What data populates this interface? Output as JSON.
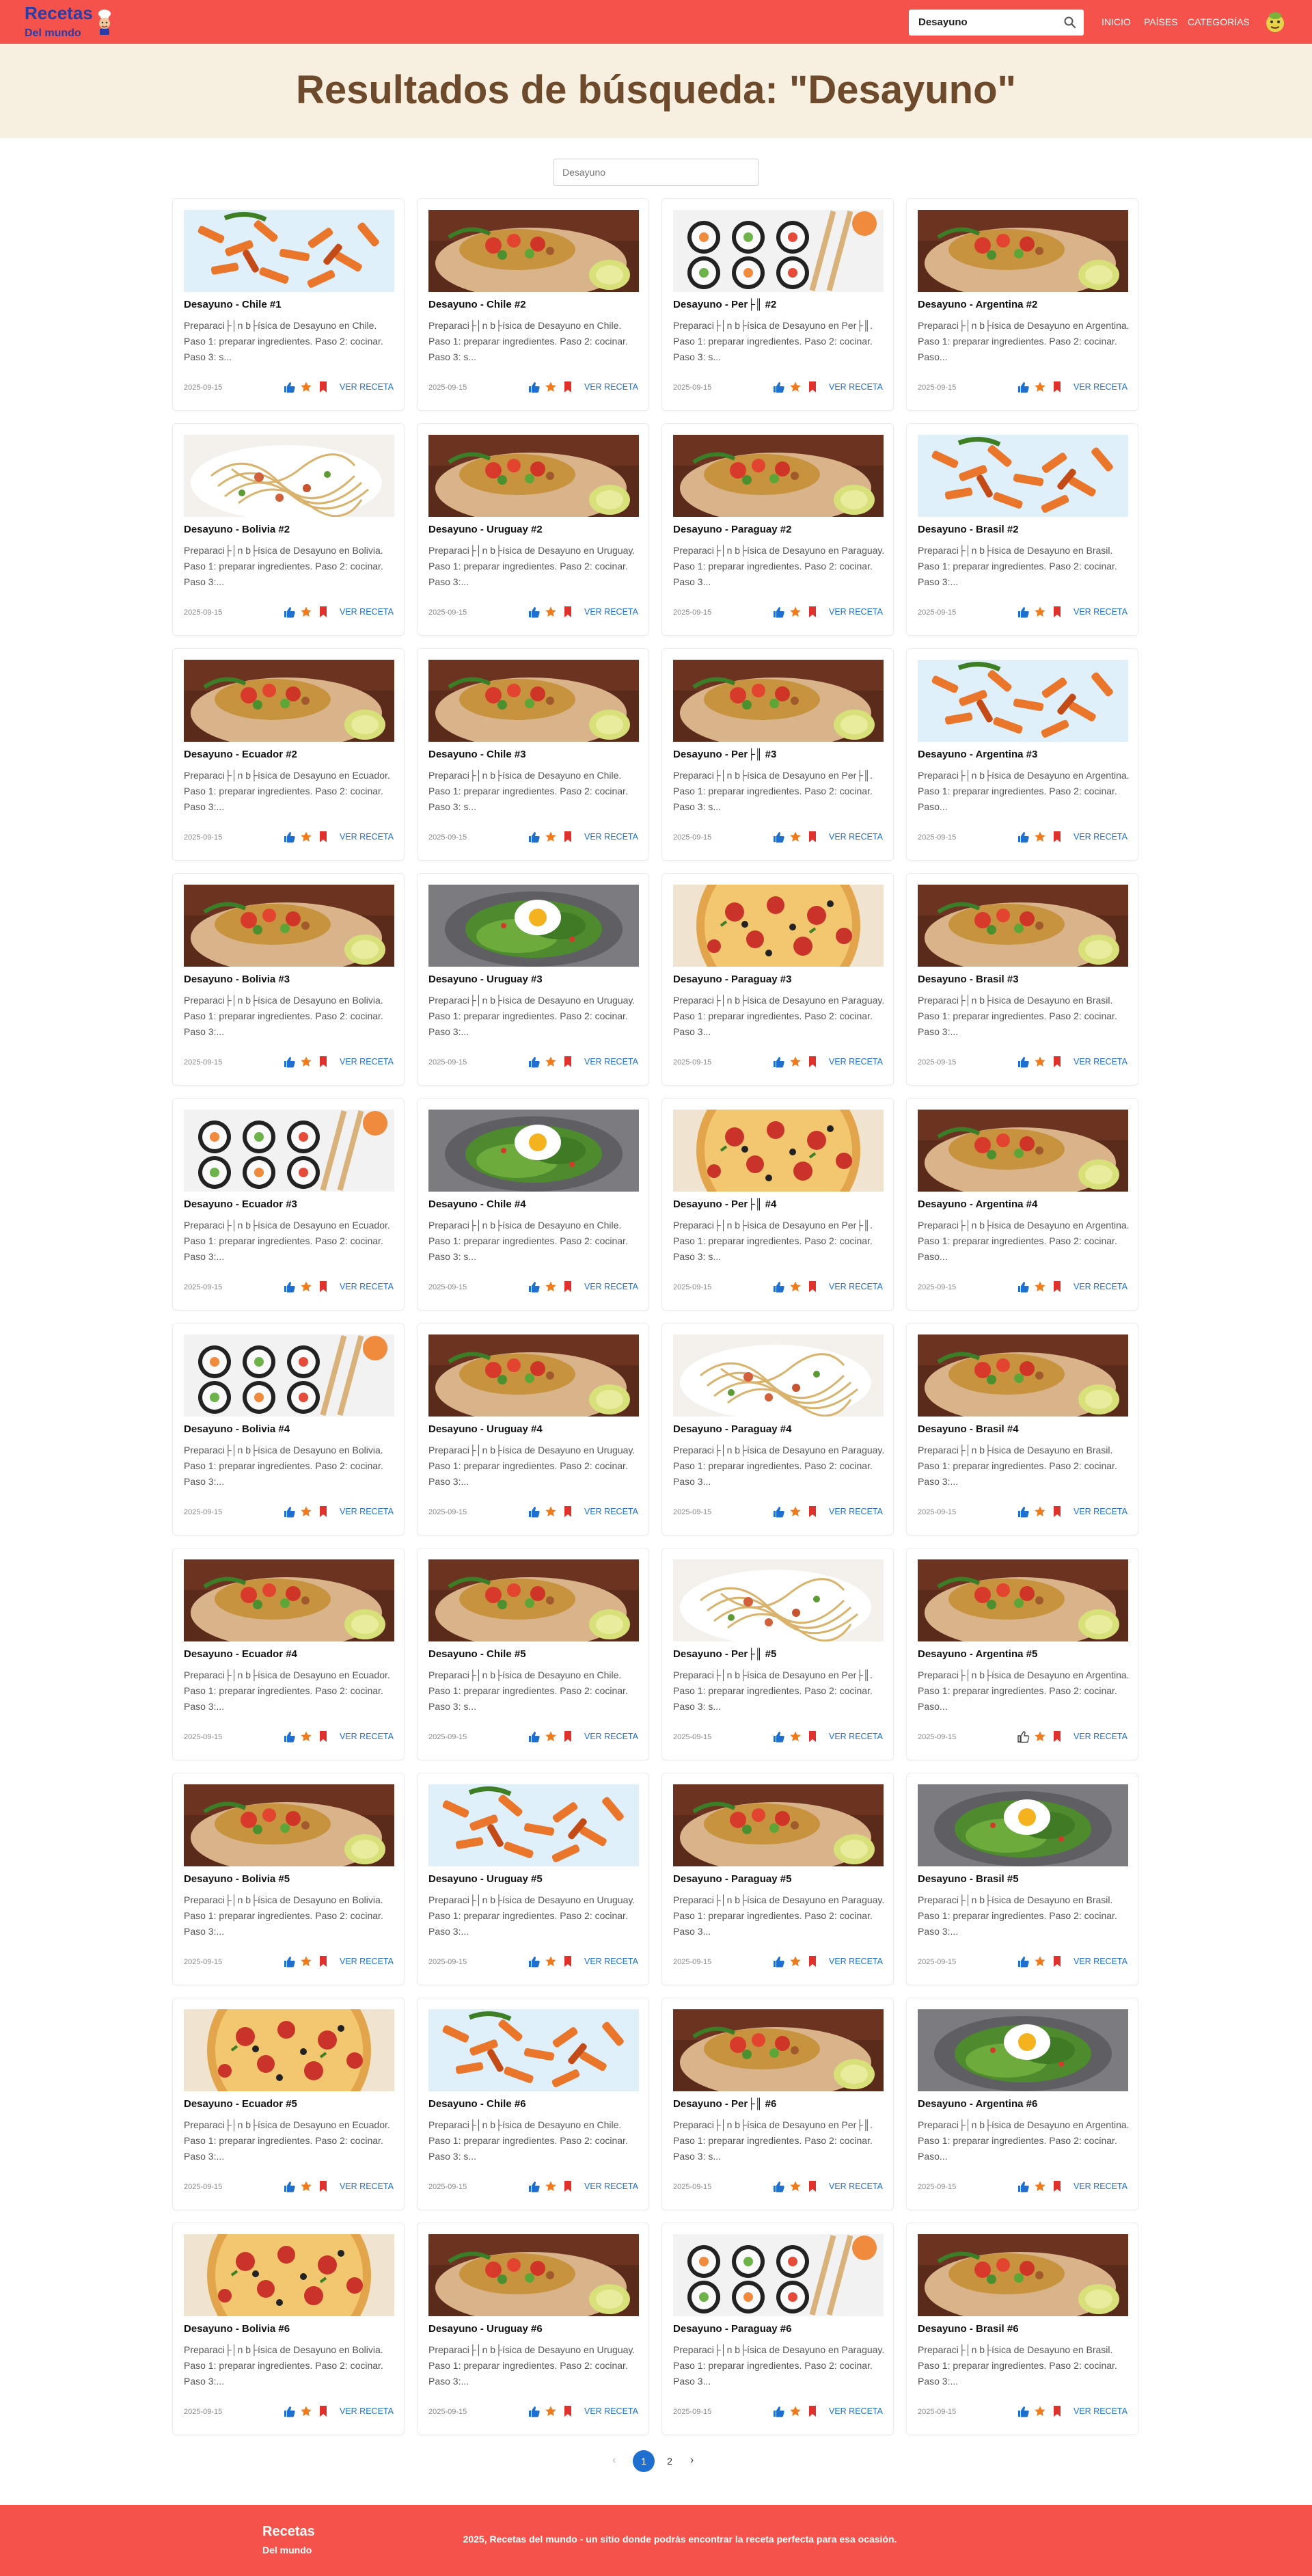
{
  "brand": {
    "title": "Recetas",
    "subtitle": "Del mundo"
  },
  "nav": {
    "search_value": "Desayuno",
    "links": [
      "INICIO",
      "PAÍSES",
      "CATEGORÍAS"
    ]
  },
  "hero": {
    "title": "Resultados de búsqueda: \"Desayuno\""
  },
  "filter": {
    "placeholder": "Desayuno"
  },
  "card_ui": {
    "date": "2025-09-15",
    "view_label": "VER RECETA"
  },
  "recipes": [
    {
      "title": "Desayuno - Chile #1",
      "desc": "Preparaci├│n b├ísica de Desayuno en Chile. Paso 1: preparar ingredientes. Paso 2: cocinar. Paso 3: s...",
      "image": "penne-pasta",
      "liked": true
    },
    {
      "title": "Desayuno - Chile #2",
      "desc": "Preparaci├│n b├ísica de Desayuno en Chile. Paso 1: preparar ingredientes. Paso 2: cocinar. Paso 3: s...",
      "image": "burrito",
      "liked": true
    },
    {
      "title": "Desayuno - Per├║ #2",
      "desc": "Preparaci├│n b├ísica de Desayuno en Per├║. Paso 1: preparar ingredientes. Paso 2: cocinar. Paso 3: s...",
      "image": "sushi",
      "liked": true
    },
    {
      "title": "Desayuno - Argentina #2",
      "desc": "Preparaci├│n b├ísica de Desayuno en Argentina. Paso 1: preparar ingredientes. Paso 2: cocinar. Paso...",
      "image": "burrito",
      "liked": true
    },
    {
      "title": "Desayuno - Bolivia #2",
      "desc": "Preparaci├│n b├ísica de Desayuno en Bolivia. Paso 1: preparar ingredientes. Paso 2: cocinar. Paso 3:...",
      "image": "spaghetti",
      "liked": true
    },
    {
      "title": "Desayuno - Uruguay #2",
      "desc": "Preparaci├│n b├ísica de Desayuno en Uruguay. Paso 1: preparar ingredientes. Paso 2: cocinar. Paso 3:...",
      "image": "burrito",
      "liked": true
    },
    {
      "title": "Desayuno - Paraguay #2",
      "desc": "Preparaci├│n b├ísica de Desayuno en Paraguay. Paso 1: preparar ingredientes. Paso 2: cocinar. Paso 3...",
      "image": "burrito",
      "liked": true
    },
    {
      "title": "Desayuno - Brasil #2",
      "desc": "Preparaci├│n b├ísica de Desayuno en Brasil. Paso 1: preparar ingredientes. Paso 2: cocinar. Paso 3:...",
      "image": "penne-pasta",
      "liked": true
    },
    {
      "title": "Desayuno - Ecuador #2",
      "desc": "Preparaci├│n b├ísica de Desayuno en Ecuador. Paso 1: preparar ingredientes. Paso 2: cocinar. Paso 3:...",
      "image": "burrito",
      "liked": true
    },
    {
      "title": "Desayuno - Chile #3",
      "desc": "Preparaci├│n b├ísica de Desayuno en Chile. Paso 1: preparar ingredientes. Paso 2: cocinar. Paso 3: s...",
      "image": "burrito",
      "liked": true
    },
    {
      "title": "Desayuno - Per├║ #3",
      "desc": "Preparaci├│n b├ísica de Desayuno en Per├║. Paso 1: preparar ingredientes. Paso 2: cocinar. Paso 3: s...",
      "image": "burrito",
      "liked": true
    },
    {
      "title": "Desayuno - Argentina #3",
      "desc": "Preparaci├│n b├ísica de Desayuno en Argentina. Paso 1: preparar ingredientes. Paso 2: cocinar. Paso...",
      "image": "penne-pasta",
      "liked": true
    },
    {
      "title": "Desayuno - Bolivia #3",
      "desc": "Preparaci├│n b├ísica de Desayuno en Bolivia. Paso 1: preparar ingredientes. Paso 2: cocinar. Paso 3:...",
      "image": "burrito",
      "liked": true
    },
    {
      "title": "Desayuno - Uruguay #3",
      "desc": "Preparaci├│n b├ísica de Desayuno en Uruguay. Paso 1: preparar ingredientes. Paso 2: cocinar. Paso 3:...",
      "image": "avocado-egg",
      "liked": true
    },
    {
      "title": "Desayuno - Paraguay #3",
      "desc": "Preparaci├│n b├ísica de Desayuno en Paraguay. Paso 1: preparar ingredientes. Paso 2: cocinar. Paso 3...",
      "image": "pizza",
      "liked": true
    },
    {
      "title": "Desayuno - Brasil #3",
      "desc": "Preparaci├│n b├ísica de Desayuno en Brasil. Paso 1: preparar ingredientes. Paso 2: cocinar. Paso 3:...",
      "image": "burrito",
      "liked": true
    },
    {
      "title": "Desayuno - Ecuador #3",
      "desc": "Preparaci├│n b├ísica de Desayuno en Ecuador. Paso 1: preparar ingredientes. Paso 2: cocinar. Paso 3:...",
      "image": "sushi",
      "liked": true
    },
    {
      "title": "Desayuno - Chile #4",
      "desc": "Preparaci├│n b├ísica de Desayuno en Chile. Paso 1: preparar ingredientes. Paso 2: cocinar. Paso 3: s...",
      "image": "avocado-egg",
      "liked": true
    },
    {
      "title": "Desayuno - Per├║ #4",
      "desc": "Preparaci├│n b├ísica de Desayuno en Per├║. Paso 1: preparar ingredientes. Paso 2: cocinar. Paso 3: s...",
      "image": "pizza",
      "liked": true
    },
    {
      "title": "Desayuno - Argentina #4",
      "desc": "Preparaci├│n b├ísica de Desayuno en Argentina. Paso 1: preparar ingredientes. Paso 2: cocinar. Paso...",
      "image": "burrito",
      "liked": true
    },
    {
      "title": "Desayuno - Bolivia #4",
      "desc": "Preparaci├│n b├ísica de Desayuno en Bolivia. Paso 1: preparar ingredientes. Paso 2: cocinar. Paso 3:...",
      "image": "sushi",
      "liked": true
    },
    {
      "title": "Desayuno - Uruguay #4",
      "desc": "Preparaci├│n b├ísica de Desayuno en Uruguay. Paso 1: preparar ingredientes. Paso 2: cocinar. Paso 3:...",
      "image": "burrito",
      "liked": true
    },
    {
      "title": "Desayuno - Paraguay #4",
      "desc": "Preparaci├│n b├ísica de Desayuno en Paraguay. Paso 1: preparar ingredientes. Paso 2: cocinar. Paso 3...",
      "image": "spaghetti",
      "liked": true
    },
    {
      "title": "Desayuno - Brasil #4",
      "desc": "Preparaci├│n b├ísica de Desayuno en Brasil. Paso 1: preparar ingredientes. Paso 2: cocinar. Paso 3:...",
      "image": "burrito",
      "liked": true
    },
    {
      "title": "Desayuno - Ecuador #4",
      "desc": "Preparaci├│n b├ísica de Desayuno en Ecuador. Paso 1: preparar ingredientes. Paso 2: cocinar. Paso 3:...",
      "image": "burrito",
      "liked": true
    },
    {
      "title": "Desayuno - Chile #5",
      "desc": "Preparaci├│n b├ísica de Desayuno en Chile. Paso 1: preparar ingredientes. Paso 2: cocinar. Paso 3: s...",
      "image": "burrito",
      "liked": true
    },
    {
      "title": "Desayuno - Per├║ #5",
      "desc": "Preparaci├│n b├ísica de Desayuno en Per├║. Paso 1: preparar ingredientes. Paso 2: cocinar. Paso 3: s...",
      "image": "spaghetti",
      "liked": true
    },
    {
      "title": "Desayuno - Argentina #5",
      "desc": "Preparaci├│n b├ísica de Desayuno en Argentina. Paso 1: preparar ingredientes. Paso 2: cocinar. Paso...",
      "image": "burrito",
      "liked": false
    },
    {
      "title": "Desayuno - Bolivia #5",
      "desc": "Preparaci├│n b├ísica de Desayuno en Bolivia. Paso 1: preparar ingredientes. Paso 2: cocinar. Paso 3:...",
      "image": "burrito",
      "liked": true
    },
    {
      "title": "Desayuno - Uruguay #5",
      "desc": "Preparaci├│n b├ísica de Desayuno en Uruguay. Paso 1: preparar ingredientes. Paso 2: cocinar. Paso 3:...",
      "image": "penne-pasta",
      "liked": true
    },
    {
      "title": "Desayuno - Paraguay #5",
      "desc": "Preparaci├│n b├ísica de Desayuno en Paraguay. Paso 1: preparar ingredientes. Paso 2: cocinar. Paso 3...",
      "image": "burrito",
      "liked": true
    },
    {
      "title": "Desayuno - Brasil #5",
      "desc": "Preparaci├│n b├ísica de Desayuno en Brasil. Paso 1: preparar ingredientes. Paso 2: cocinar. Paso 3:...",
      "image": "avocado-egg",
      "liked": true
    },
    {
      "title": "Desayuno - Ecuador #5",
      "desc": "Preparaci├│n b├ísica de Desayuno en Ecuador. Paso 1: preparar ingredientes. Paso 2: cocinar. Paso 3:...",
      "image": "pizza",
      "liked": true
    },
    {
      "title": "Desayuno - Chile #6",
      "desc": "Preparaci├│n b├ísica de Desayuno en Chile. Paso 1: preparar ingredientes. Paso 2: cocinar. Paso 3: s...",
      "image": "penne-pasta",
      "liked": true
    },
    {
      "title": "Desayuno - Per├║ #6",
      "desc": "Preparaci├│n b├ísica de Desayuno en Per├║. Paso 1: preparar ingredientes. Paso 2: cocinar. Paso 3: s...",
      "image": "burrito",
      "liked": true
    },
    {
      "title": "Desayuno - Argentina #6",
      "desc": "Preparaci├│n b├ísica de Desayuno en Argentina. Paso 1: preparar ingredientes. Paso 2: cocinar. Paso...",
      "image": "avocado-egg",
      "liked": true
    },
    {
      "title": "Desayuno - Bolivia #6",
      "desc": "Preparaci├│n b├ísica de Desayuno en Bolivia. Paso 1: preparar ingredientes. Paso 2: cocinar. Paso 3:...",
      "image": "pizza",
      "liked": true
    },
    {
      "title": "Desayuno - Uruguay #6",
      "desc": "Preparaci├│n b├ísica de Desayuno en Uruguay. Paso 1: preparar ingredientes. Paso 2: cocinar. Paso 3:...",
      "image": "burrito",
      "liked": true
    },
    {
      "title": "Desayuno - Paraguay #6",
      "desc": "Preparaci├│n b├ísica de Desayuno en Paraguay. Paso 1: preparar ingredientes. Paso 2: cocinar. Paso 3...",
      "image": "sushi",
      "liked": true
    },
    {
      "title": "Desayuno - Brasil #6",
      "desc": "Preparaci├│n b├ísica de Desayuno en Brasil. Paso 1: preparar ingredientes. Paso 2: cocinar. Paso 3:...",
      "image": "burrito",
      "liked": true
    }
  ],
  "pagination": {
    "prev": "‹",
    "pages": [
      "1",
      "2"
    ],
    "current": "1",
    "next": "›"
  },
  "footer": {
    "title": "Recetas",
    "subtitle": "Del mundo",
    "copyright": "2025, Recetas del mundo - un sitio donde podrás encontrar la receta perfecta para esa ocasión."
  },
  "colors": {
    "primary": "#f4524a",
    "brand_text": "#2a3da6",
    "hero_bg": "#f7efe0",
    "hero_title": "#6e4a2c",
    "link": "#1e6fcf",
    "star": "#f07b1d",
    "bookmark": "#e0322c"
  }
}
